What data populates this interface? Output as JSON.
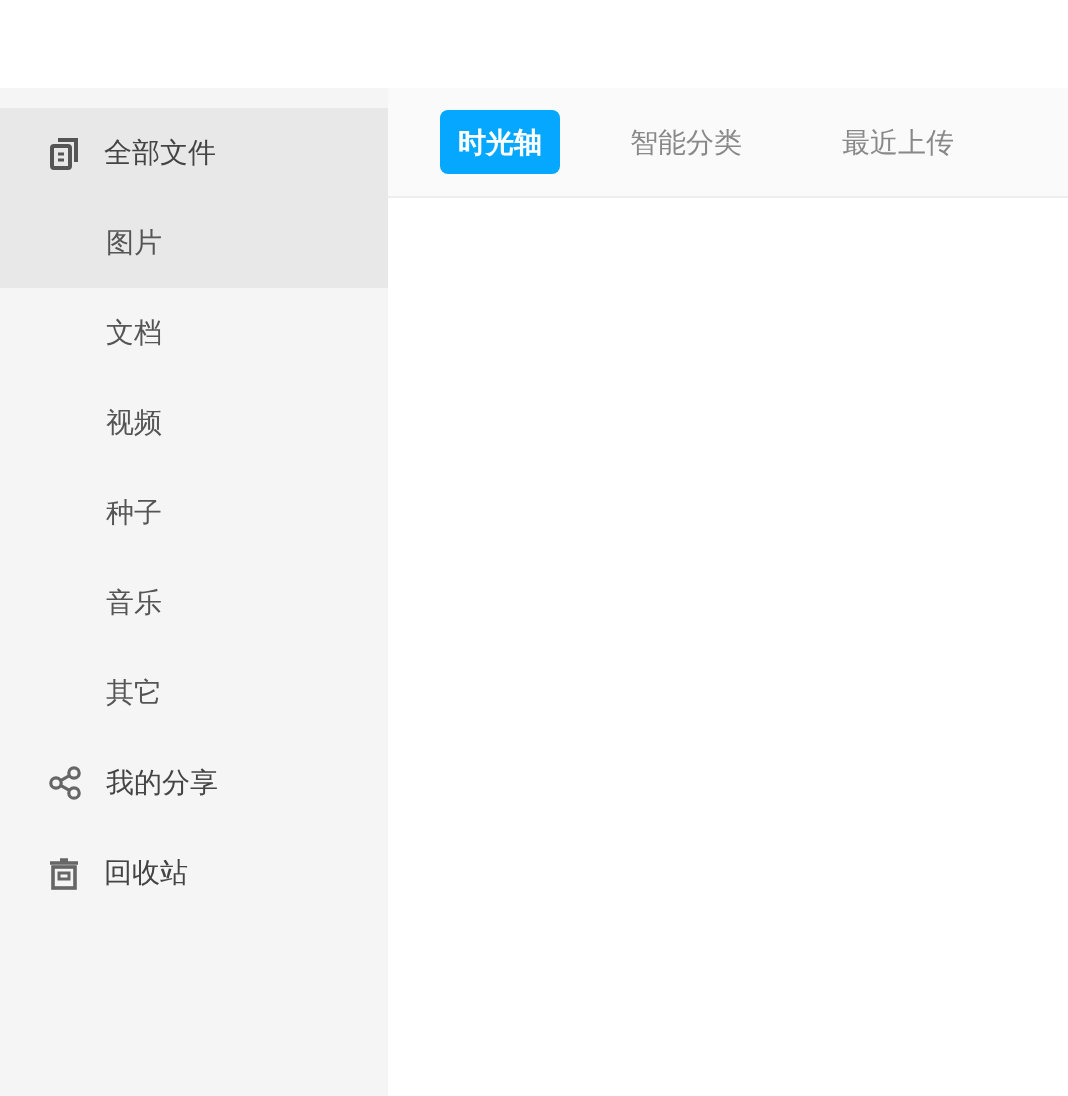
{
  "sidebar": {
    "items": [
      {
        "label": "全部文件",
        "kind": "files",
        "selected": true,
        "children": [
          {
            "label": "图片",
            "selected": true
          },
          {
            "label": "文档",
            "selected": false
          },
          {
            "label": "视频",
            "selected": false
          },
          {
            "label": "种子",
            "selected": false
          },
          {
            "label": "音乐",
            "selected": false
          },
          {
            "label": "其它",
            "selected": false
          }
        ]
      },
      {
        "label": "我的分享",
        "kind": "share",
        "selected": false
      },
      {
        "label": "回收站",
        "kind": "trash",
        "selected": false
      }
    ]
  },
  "tabs": [
    {
      "label": "时光轴",
      "selected": true
    },
    {
      "label": "智能分类",
      "selected": false
    },
    {
      "label": "最近上传",
      "selected": false
    }
  ]
}
